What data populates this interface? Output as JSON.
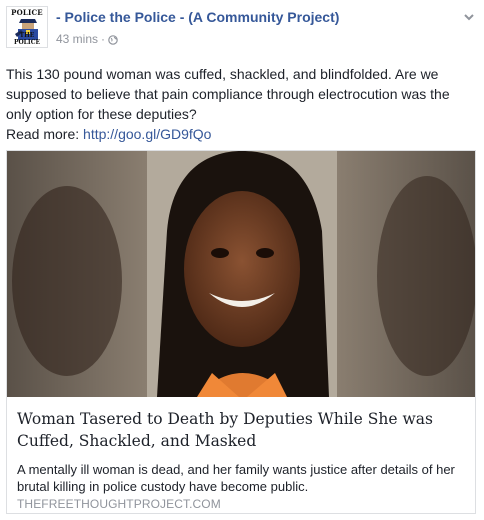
{
  "post": {
    "page_name": "- Police the Police - (A Community Project)",
    "timestamp": "43 mins",
    "separator": "·",
    "privacy_icon": "globe-icon",
    "menu_icon": "chevron-down-icon",
    "body": "This 130 pound woman was cuffed, shackled, and blindfolded. Are we supposed to believe that pain compliance through electrocution was the only option for these deputies?",
    "read_more_label": "Read more:",
    "read_more_link": "http://goo.gl/GD9fQo"
  },
  "avatar": {
    "top_text": "POLICE",
    "bottom_text": "THE POLICE"
  },
  "link_card": {
    "title": "Woman Tasered to Death by Deputies While She was Cuffed, Shackled, and Masked",
    "description": "A mentally ill woman is dead, and her family wants justice after details of her brutal killing in police custody have become public.",
    "domain": "THEFREETHOUGHTPROJECT.COM"
  },
  "colors": {
    "link": "#365899",
    "meta": "#90949c",
    "text": "#1d2129",
    "border": "#dddfe2"
  }
}
